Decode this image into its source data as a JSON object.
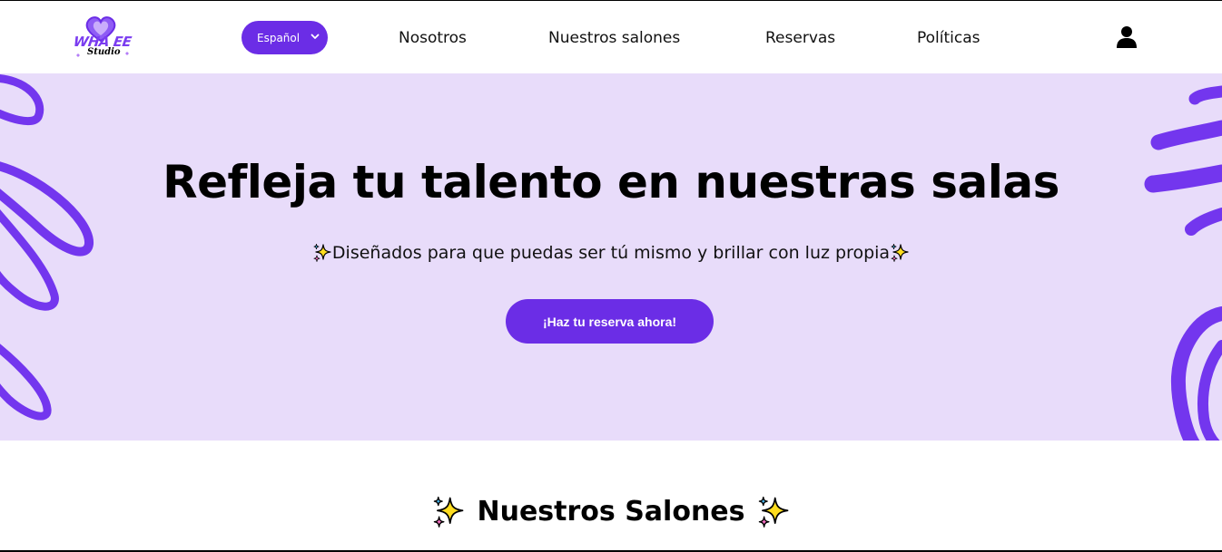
{
  "brand": {
    "logo_text": "WHA EE",
    "logo_sub": "Studio"
  },
  "header": {
    "language": {
      "selected": "Español"
    },
    "nav": [
      {
        "label": "Nosotros"
      },
      {
        "label": "Nuestros salones"
      },
      {
        "label": "Reservas"
      },
      {
        "label": "Políticas"
      }
    ],
    "icons": {
      "language_dropdown": "chevron-down-icon",
      "account": "user-icon"
    }
  },
  "hero": {
    "title": "Refleja tu talento en nuestras salas",
    "subtitle": "Diseñados para que puedas ser tú mismo y brillar con luz propia",
    "cta_label": "¡Haz tu reserva ahora!",
    "decoration_icon": "sparkles-icon"
  },
  "section": {
    "title": "Nuestros Salones"
  },
  "colors": {
    "accent": "#6b2de6",
    "hero_background": "#e8dcfa",
    "brush_strokes": "#7336ee",
    "sparkle_yellow": "#ffdd1f",
    "sparkle_pink": "#f56fc2",
    "sparkle_blue": "#47b8f0"
  }
}
